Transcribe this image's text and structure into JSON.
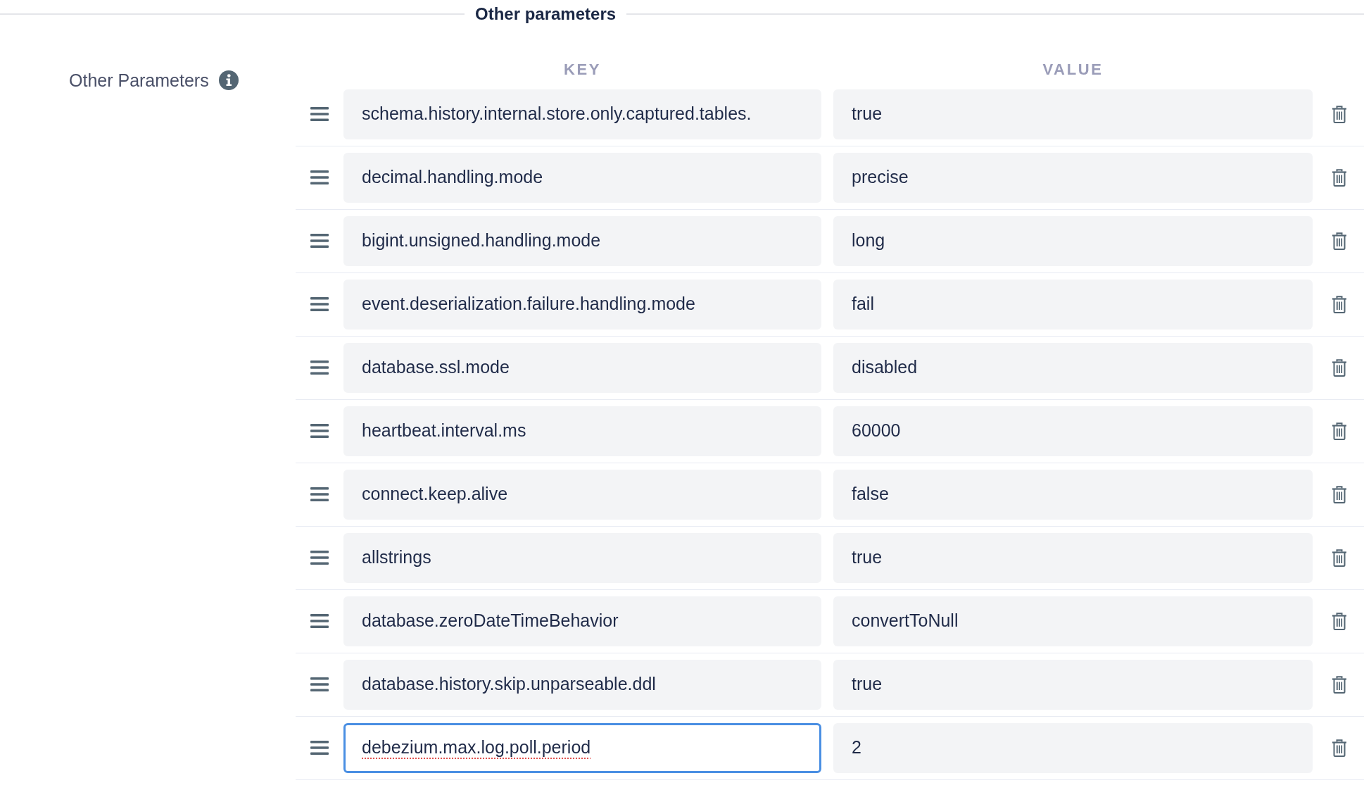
{
  "section": {
    "title": "Other parameters"
  },
  "field": {
    "label": "Other Parameters"
  },
  "columns": [
    "KEY",
    "VALUE"
  ],
  "rows": [
    {
      "key": "schema.history.internal.store.only.captured.tables.",
      "value": "true",
      "key_focused": false,
      "key_misspelled": false
    },
    {
      "key": "decimal.handling.mode",
      "value": "precise",
      "key_focused": false,
      "key_misspelled": false
    },
    {
      "key": "bigint.unsigned.handling.mode",
      "value": "long",
      "key_focused": false,
      "key_misspelled": false
    },
    {
      "key": "event.deserialization.failure.handling.mode",
      "value": "fail",
      "key_focused": false,
      "key_misspelled": false
    },
    {
      "key": "database.ssl.mode",
      "value": "disabled",
      "key_focused": false,
      "key_misspelled": false
    },
    {
      "key": "heartbeat.interval.ms",
      "value": "60000",
      "key_focused": false,
      "key_misspelled": false
    },
    {
      "key": "connect.keep.alive",
      "value": "false",
      "key_focused": false,
      "key_misspelled": false
    },
    {
      "key": "allstrings",
      "value": "true",
      "key_focused": false,
      "key_misspelled": false
    },
    {
      "key": "database.zeroDateTimeBehavior",
      "value": "convertToNull",
      "key_focused": false,
      "key_misspelled": false
    },
    {
      "key": "database.history.skip.unparseable.ddl",
      "value": "true",
      "key_focused": false,
      "key_misspelled": false
    },
    {
      "key": "debezium.max.log.poll.period",
      "value": "2",
      "key_focused": true,
      "key_misspelled": true
    }
  ]
}
